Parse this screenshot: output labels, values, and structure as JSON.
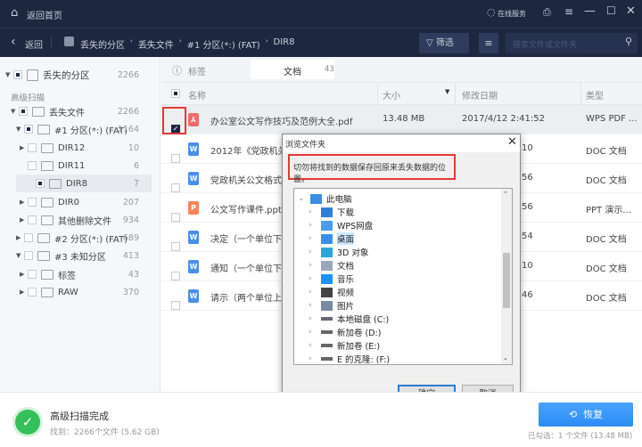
{
  "titlebar": {
    "home": "返回首页",
    "service": "在线服务"
  },
  "navbar": {
    "back": "返回",
    "breadcrumb": [
      "丢失的分区",
      "丢失文件",
      "#1 分区(*:) (FAT)",
      "DIR8"
    ],
    "filter": "筛选",
    "search_placeholder": "搜索文件或文件夹"
  },
  "sidebar": {
    "root": {
      "label": "丢失的分区",
      "count": "2266"
    },
    "section": "高级扫描",
    "items": [
      {
        "label": "丢失文件",
        "count": "2266"
      },
      {
        "label": "#1 分区(*:) (FAT)",
        "count": "1164"
      },
      {
        "label": "DIR12",
        "count": "10"
      },
      {
        "label": "DIR11",
        "count": "6"
      },
      {
        "label": "DIR8",
        "count": "7"
      },
      {
        "label": "DIR0",
        "count": "207"
      },
      {
        "label": "其他删除文件",
        "count": "934"
      },
      {
        "label": "#2 分区(*:) (FAT)",
        "count": "689"
      },
      {
        "label": "#3 未知分区",
        "count": "413"
      },
      {
        "label": "标签",
        "count": "43"
      },
      {
        "label": "RAW",
        "count": "370"
      }
    ]
  },
  "tabs": {
    "tag_label": "标签",
    "doc_tab": "文档",
    "doc_count": "43"
  },
  "table": {
    "headers": {
      "name": "名称",
      "size": "大小",
      "date": "修改日期",
      "type": "类型"
    },
    "rows": [
      {
        "name": "办公室公文写作技巧及范例大全.pdf",
        "size": "13.48 MB",
        "date": "2017/4/12 2:41:52",
        "type": "WPS PDF ...",
        "icon": "pdf",
        "checked": true
      },
      {
        "name": "2012年《党政机关",
        "date": "10",
        "type": "DOC 文档",
        "icon": "doc"
      },
      {
        "name": "党政机关公文格式",
        "date": "56",
        "type": "DOC 文档",
        "icon": "doc"
      },
      {
        "name": "公文写作课件.pptx",
        "date": "56",
        "type": "PPT 演示...",
        "icon": "ppt"
      },
      {
        "name": "决定（一个单位下",
        "date": "54",
        "type": "DOC 文档",
        "icon": "doc"
      },
      {
        "name": "通知（一个单位下",
        "date": "10",
        "type": "DOC 文档",
        "icon": "doc"
      },
      {
        "name": "请示（两个单位上",
        "date": "46",
        "type": "DOC 文档",
        "icon": "doc"
      }
    ]
  },
  "dialog": {
    "title": "浏览文件夹",
    "message": "切勿将找到的数据保存回原来丢失数据的位置。",
    "tree": [
      "此电脑",
      "下载",
      "WPS网盘",
      "桌面",
      "3D 对象",
      "文档",
      "音乐",
      "视频",
      "图片",
      "本地磁盘 (C:)",
      "新加卷 (D:)",
      "新加卷 (E:)",
      "E 的克隆: (F:)"
    ],
    "ok": "确定",
    "cancel": "取消"
  },
  "status": {
    "title": "高级扫描完成",
    "found": "找到：2266个文件 (5.62 GB)",
    "recover": "恢复",
    "selected": "已勾选：1 个文件 (13.48 MB)"
  },
  "colors": {
    "navy": "#1d2840",
    "accent": "#2b8cf5",
    "highlight": "#e53935"
  }
}
